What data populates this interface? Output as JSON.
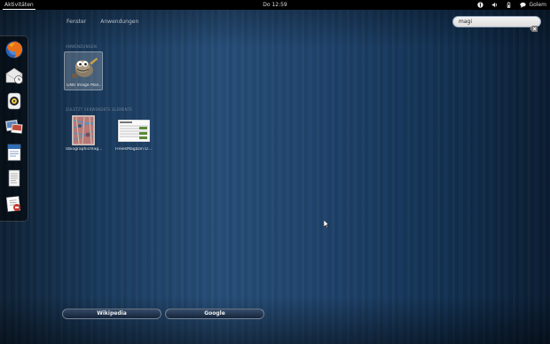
{
  "topbar": {
    "activities": "Aktivitäten",
    "clock": "Do 12:59",
    "user": "Golem"
  },
  "tabs": [
    {
      "label": "Fenster"
    },
    {
      "label": "Anwendungen"
    }
  ],
  "search": {
    "query": "magi"
  },
  "dash": {
    "items": [
      {
        "icon": "firefox-icon"
      },
      {
        "icon": "evolution-mail-icon"
      },
      {
        "icon": "rhythmbox-icon"
      },
      {
        "icon": "shotwell-photos-icon"
      },
      {
        "icon": "writer-document-icon"
      },
      {
        "icon": "text-editor-icon"
      },
      {
        "icon": "file-roller-icon"
      }
    ]
  },
  "results": {
    "applications": {
      "title": "ANWENDUNGEN",
      "items": [
        {
          "label": "GNU Image Man..."
        }
      ]
    },
    "documents": {
      "title": "ZULETZT VERWENDETE ELEMENTE",
      "items": [
        {
          "label": "Ubiographicmag..."
        },
        {
          "label": "FreiesMagazin D..."
        }
      ]
    }
  },
  "providers": [
    {
      "label": "Wikipedia"
    },
    {
      "label": "Google"
    }
  ],
  "colors": {
    "accent": "#274e78",
    "panel": "#000000"
  }
}
